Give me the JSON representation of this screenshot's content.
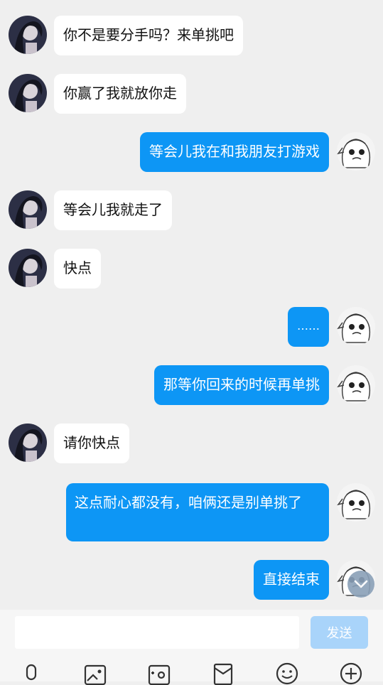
{
  "messages": [
    {
      "side": "left",
      "text": "你不是要分手吗？来单挑吧"
    },
    {
      "side": "left",
      "text": "你赢了我就放你走"
    },
    {
      "side": "right",
      "text": "等会儿我在和我朋友打游戏"
    },
    {
      "side": "left",
      "text": "等会儿我就走了"
    },
    {
      "side": "left",
      "text": "快点"
    },
    {
      "side": "right",
      "text": "……"
    },
    {
      "side": "right",
      "text": "那等你回来的时候再单挑"
    },
    {
      "side": "left",
      "text": "请你快点"
    },
    {
      "side": "right",
      "text": "这点耐心都没有，咱俩还是别单挑了"
    },
    {
      "side": "right",
      "text": "直接结束"
    }
  ],
  "composer": {
    "placeholder": "",
    "send_label": "发送"
  },
  "toolbar": [
    "mic-icon",
    "image-icon",
    "camera-icon",
    "red-packet-icon",
    "emoji-icon",
    "plus-icon"
  ],
  "colors": {
    "outgoing_bubble": "#0d96f5",
    "incoming_bubble": "#ffffff",
    "background": "#efefef",
    "send_disabled": "#a9d4fa"
  }
}
